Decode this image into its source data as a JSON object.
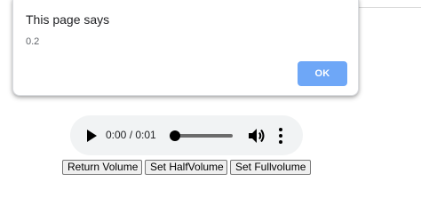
{
  "dialog": {
    "title": "This page says",
    "message": "0.2",
    "ok_label": "OK"
  },
  "audio": {
    "current_time": "0:00",
    "duration": "0:01",
    "time_display": "0:00 / 0:01",
    "progress": 0,
    "icons": {
      "play": "play-icon",
      "volume": "volume-icon",
      "more": "more-vertical-icon"
    }
  },
  "buttons": {
    "return_volume": "Return Volume",
    "set_half_volume": "Set HalfVolume",
    "set_full_volume": "Set Fullvolume"
  },
  "colors": {
    "ok_button": "#6ea7f7",
    "player_background": "#f1f3f4",
    "button_background": "#efefef"
  }
}
